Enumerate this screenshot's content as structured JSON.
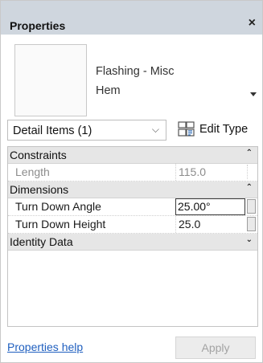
{
  "window": {
    "title": "Properties",
    "close_glyph": "×"
  },
  "type_selector": {
    "family": "Flashing - Misc",
    "type": "Hem",
    "dropdown_icon": "caret-down-icon"
  },
  "instance": {
    "selected": "Detail Items (1)",
    "chevron_glyph": "⌵",
    "edit_type_label": "Edit Type",
    "edit_type_icon": "edit-type-icon"
  },
  "groups": [
    {
      "label": "Constraints",
      "toggle_glyph": "⌃",
      "expanded": true,
      "properties": [
        {
          "name": "Length",
          "value": "115.0",
          "readonly": true
        }
      ]
    },
    {
      "label": "Dimensions",
      "toggle_glyph": "⌃",
      "expanded": true,
      "properties": [
        {
          "name": "Turn Down Angle",
          "value": "25.00°",
          "readonly": false,
          "active": true
        },
        {
          "name": "Turn Down Height",
          "value": "25.0",
          "readonly": false
        }
      ]
    },
    {
      "label": "Identity Data",
      "toggle_glyph": "⌄",
      "expanded": false,
      "properties": []
    }
  ],
  "footer": {
    "help_link": "Properties help",
    "apply_label": "Apply",
    "apply_enabled": false
  },
  "colors": {
    "titlebar": "#cfd6de",
    "group_header": "#e6e6e6",
    "link": "#1f5fbf",
    "disabled_text": "#a3a3a3"
  }
}
